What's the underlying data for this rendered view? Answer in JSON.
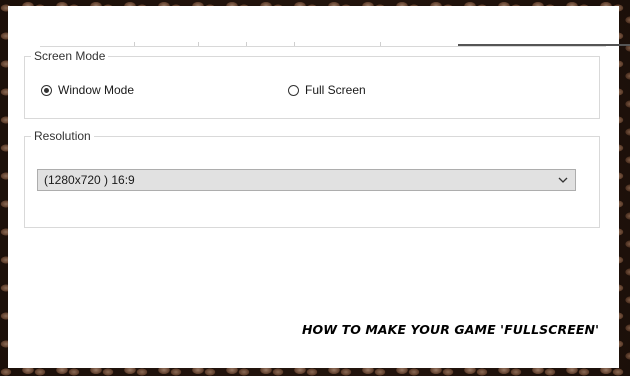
{
  "screen_mode": {
    "legend": "Screen Mode",
    "options": [
      {
        "label": "Window Mode",
        "checked": true
      },
      {
        "label": "Full Screen",
        "checked": false
      }
    ]
  },
  "resolution": {
    "legend": "Resolution",
    "selected": "(1280x720 ) 16:9"
  },
  "caption": "HOW TO MAKE YOUR GAME 'FULLSCREEN'",
  "icons": {
    "dropdown": "chevron-down-icon"
  },
  "colors": {
    "panel": "#ffffff",
    "select_bg": "#e1e1e1",
    "active_tab_line": "#555555"
  }
}
